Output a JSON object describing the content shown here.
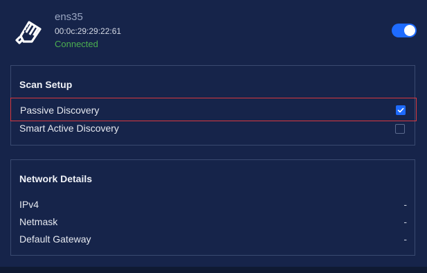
{
  "interface": {
    "name": "ens35",
    "mac": "00:0c:29:29:22:61",
    "status": "Connected",
    "enabled": true
  },
  "scan_setup": {
    "title": "Scan Setup",
    "options": [
      {
        "label": "Passive Discovery",
        "checked": true
      },
      {
        "label": "Smart Active Discovery",
        "checked": false
      }
    ]
  },
  "network_details": {
    "title": "Network Details",
    "rows": [
      {
        "label": "IPv4",
        "value": "-"
      },
      {
        "label": "Netmask",
        "value": "-"
      },
      {
        "label": "Default Gateway",
        "value": "-"
      }
    ]
  },
  "colors": {
    "background": "#16244a",
    "accent": "#1e6bff",
    "connected": "#4caf50",
    "selection_outline": "#d9393f"
  },
  "icons": {
    "interface": "ethernet-plug-icon",
    "checkmark": "check-icon"
  }
}
